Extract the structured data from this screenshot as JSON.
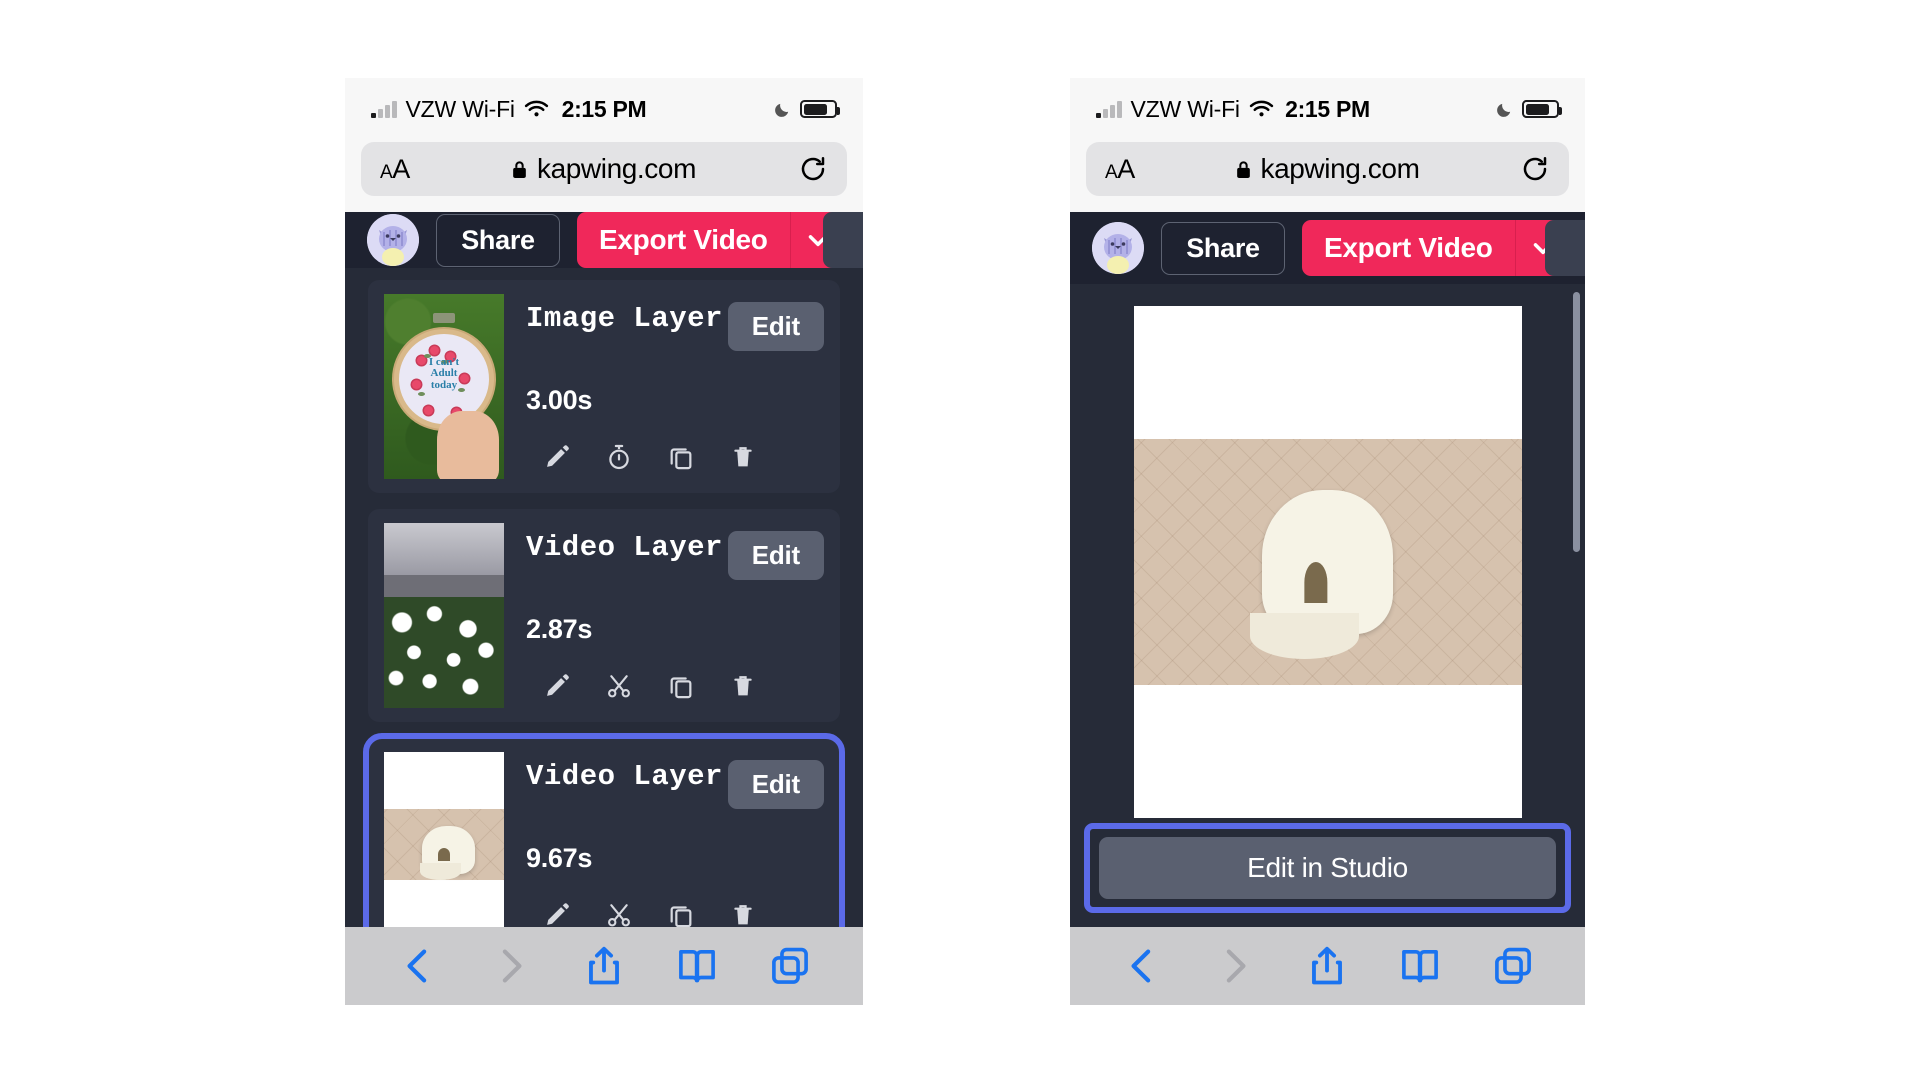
{
  "status_bar": {
    "carrier": "VZW Wi-Fi",
    "time": "2:15 PM",
    "signal_icon": "cellular-signal-icon",
    "wifi_icon": "wifi-icon",
    "moon_icon": "do-not-disturb-moon-icon",
    "battery_icon": "battery-icon"
  },
  "browser": {
    "text_size_label": "AA",
    "lock_icon": "lock-icon",
    "url": "kapwing.com",
    "reload_icon": "reload-icon",
    "toolbar": {
      "back_icon": "back-chevron-icon",
      "forward_icon": "forward-chevron-icon",
      "share_icon": "share-icon",
      "bookmarks_icon": "bookmarks-book-icon",
      "tabs_icon": "tabs-icon"
    }
  },
  "app": {
    "avatar_icon": "user-avatar-cat-icon",
    "share_label": "Share",
    "export_label": "Export Video",
    "export_caret_icon": "chevron-down-icon",
    "layers": [
      {
        "title": "Image Layer",
        "duration": "3.00s",
        "edit_label": "Edit",
        "thumbnail": "embroidery-hoop-thumbnail",
        "thumbnail_text": [
          "I can't",
          "Adult",
          "today"
        ],
        "selected": false,
        "actions": [
          "pencil-edit-icon",
          "timer-icon",
          "duplicate-icon",
          "trash-delete-icon"
        ]
      },
      {
        "title": "Video Layer",
        "duration": "2.87s",
        "edit_label": "Edit",
        "thumbnail": "white-flowers-video-thumbnail",
        "selected": false,
        "actions": [
          "pencil-edit-icon",
          "scissors-split-icon",
          "duplicate-icon",
          "trash-delete-icon"
        ]
      },
      {
        "title": "Video Layer",
        "duration": "9.67s",
        "edit_label": "Edit",
        "thumbnail": "white-cap-video-thumbnail",
        "selected": true,
        "actions": [
          "pencil-edit-icon",
          "scissors-split-icon",
          "duplicate-icon",
          "trash-delete-icon"
        ]
      }
    ],
    "preview": {
      "canvas_art": "white-cap-on-quilt-preview",
      "scrollbar": "vertical-scrollbar"
    },
    "edit_in_studio_label": "Edit in Studio"
  },
  "colors": {
    "accent_red": "#f0285a",
    "selection_blue": "#5b6ae8",
    "app_bg": "#262b38",
    "app_topbar": "#1e2230",
    "card_bg": "#2c3140",
    "button_gray": "#5a6070",
    "safari_chrome": "#f7f7f7",
    "safari_toolbar": "#cbcbcd",
    "safari_blue": "#1a73f0"
  }
}
